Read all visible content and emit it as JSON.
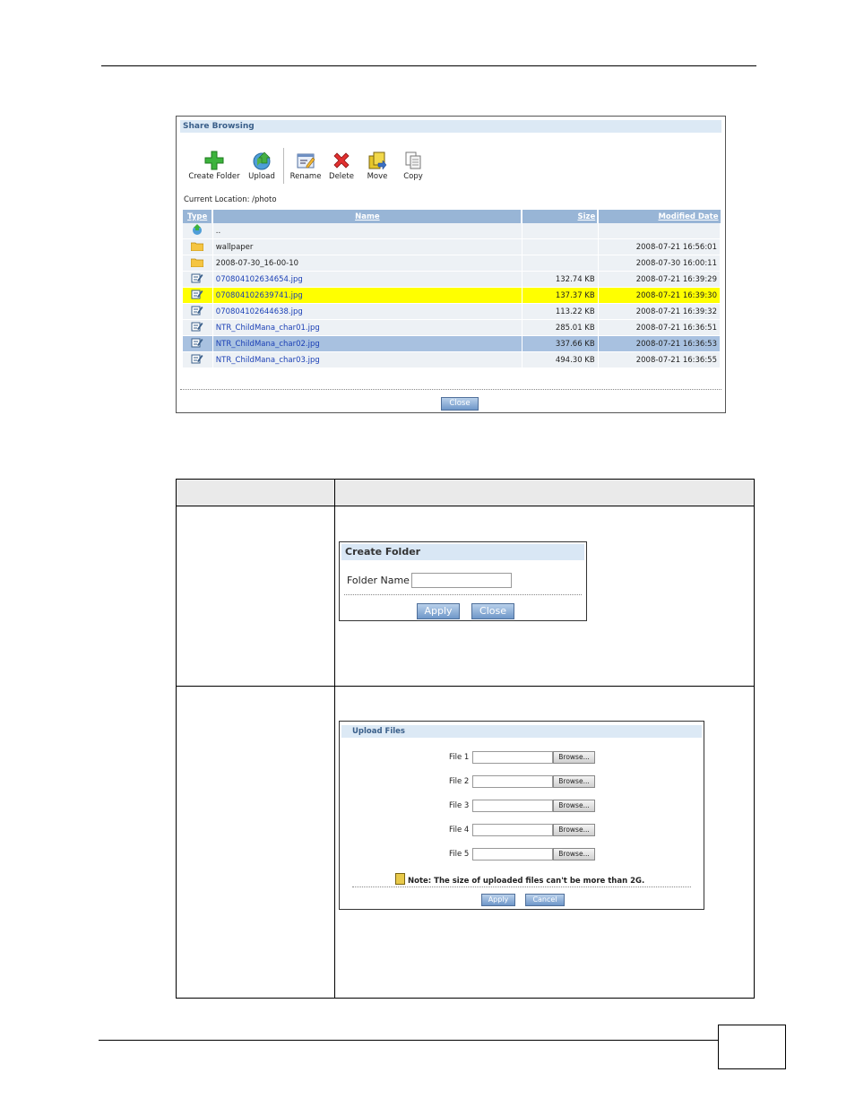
{
  "share_browsing": {
    "title": "Share Browsing",
    "toolbar": {
      "create_folder": "Create Folder",
      "upload": "Upload",
      "rename": "Rename",
      "delete": "Delete",
      "move": "Move",
      "copy": "Copy"
    },
    "location": "Current Location: /photo",
    "columns": {
      "type": "Type",
      "name": "Name",
      "size": "Size",
      "modified": "Modified Date"
    },
    "rows": [
      {
        "name": "..",
        "size": "",
        "date": "",
        "kind": "up"
      },
      {
        "name": "wallpaper",
        "size": "",
        "date": "2008-07-21 16:56:01",
        "kind": "folder"
      },
      {
        "name": "2008-07-30_16-00-10",
        "size": "",
        "date": "2008-07-30 16:00:11",
        "kind": "folder"
      },
      {
        "name": "070804102634654.jpg",
        "size": "132.74 KB",
        "date": "2008-07-21 16:39:29",
        "kind": "file"
      },
      {
        "name": "070804102639741.jpg",
        "size": "137.37 KB",
        "date": "2008-07-21 16:39:30",
        "kind": "file"
      },
      {
        "name": "070804102644638.jpg",
        "size": "113.22 KB",
        "date": "2008-07-21 16:39:32",
        "kind": "file"
      },
      {
        "name": "NTR_ChildMana_char01.jpg",
        "size": "285.01 KB",
        "date": "2008-07-21 16:36:51",
        "kind": "file"
      },
      {
        "name": "NTR_ChildMana_char02.jpg",
        "size": "337.66 KB",
        "date": "2008-07-21 16:36:53",
        "kind": "file"
      },
      {
        "name": "NTR_ChildMana_char03.jpg",
        "size": "494.30 KB",
        "date": "2008-07-21 16:36:55",
        "kind": "file"
      }
    ],
    "close": "Close"
  },
  "create_folder": {
    "title": "Create Folder",
    "label": "Folder Name",
    "value": "",
    "apply": "Apply",
    "close": "Close"
  },
  "upload_files": {
    "title": "Upload Files",
    "files": [
      "File 1",
      "File 2",
      "File 3",
      "File 4",
      "File 5"
    ],
    "browse": "Browse...",
    "note": "Note: The size of uploaded files can't be more than 2G.",
    "apply": "Apply",
    "cancel": "Cancel"
  },
  "colors": {
    "header_blue": "#98b5d6",
    "highlight": "#ffff00",
    "selected": "#a8c1e0",
    "link": "#1a3fb5"
  }
}
